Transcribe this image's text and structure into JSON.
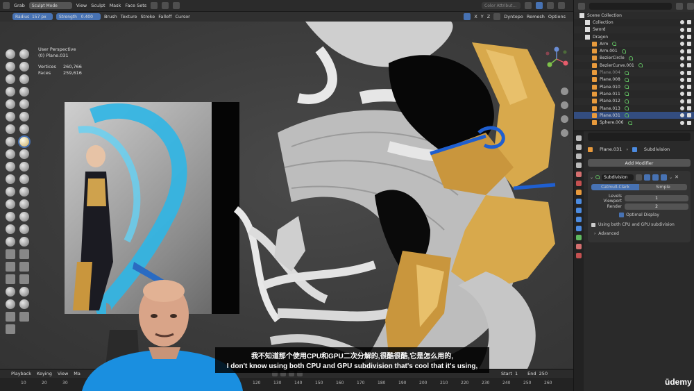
{
  "header": {
    "tool": "Grab",
    "mode": "Sculpt Mode",
    "menus": [
      "View",
      "Sculpt",
      "Mask",
      "Face Sets"
    ],
    "radius_label": "Radius",
    "radius_value": "157 px",
    "strength_label": "Strength",
    "strength_value": "0.400",
    "dropdowns": [
      "Brush",
      "Texture",
      "Stroke",
      "Falloff",
      "Cursor"
    ],
    "color_attr": "Color Attribut...",
    "axes": [
      "X",
      "Y",
      "Z"
    ],
    "dyntopo": "Dyntopo",
    "remesh": "Remesh",
    "options": "Options"
  },
  "viewport": {
    "view_name": "User Perspective",
    "object_name": "(0) Plane.031",
    "vertices_label": "Vertices",
    "vertices_value": "260,766",
    "faces_label": "Faces",
    "faces_value": "259,616"
  },
  "outliner": {
    "items": [
      {
        "label": "Scene Collection",
        "type": "scene"
      },
      {
        "label": "Collection",
        "type": "coll"
      },
      {
        "label": "Sword",
        "type": "coll"
      },
      {
        "label": "Dragon",
        "type": "coll"
      },
      {
        "label": "Arm",
        "type": "obj"
      },
      {
        "label": "Arm.001",
        "type": "obj"
      },
      {
        "label": "BezierCircle",
        "type": "obj"
      },
      {
        "label": "BezierCurve.001",
        "type": "obj"
      },
      {
        "label": "Plane.004",
        "type": "obj",
        "dim": true
      },
      {
        "label": "Plane.008",
        "type": "obj"
      },
      {
        "label": "Plane.010",
        "type": "obj"
      },
      {
        "label": "Plane.011",
        "type": "obj"
      },
      {
        "label": "Plane.012",
        "type": "obj"
      },
      {
        "label": "Plane.013",
        "type": "obj"
      },
      {
        "label": "Plane.031",
        "type": "obj",
        "selected": true
      },
      {
        "label": "Sphere.006",
        "type": "obj"
      }
    ]
  },
  "properties": {
    "object": "Plane.031",
    "modifier_crumb": "Subdivision",
    "add_modifier": "Add Modifier",
    "modifier_name": "Subdivision",
    "type_a": "Catmull-Clark",
    "type_b": "Simple",
    "levels_label": "Levels Viewport",
    "levels_value": "1",
    "render_label": "Render",
    "render_value": "2",
    "optimal_display": "Optimal Display",
    "note": "Using both CPU and GPU subdivision",
    "advanced": "Advanced"
  },
  "timeline": {
    "menus": [
      "Playback",
      "Keying",
      "View",
      "Ma"
    ],
    "ticks": [
      "10",
      "20",
      "30",
      "120",
      "130",
      "140",
      "150",
      "160",
      "170",
      "180",
      "190",
      "200",
      "210",
      "220",
      "230",
      "240",
      "250",
      "260"
    ],
    "start_label": "Start",
    "start_value": "1",
    "end_label": "End",
    "end_value": "250"
  },
  "subtitles": {
    "zh": "我不知道那个使用CPU和GPU二次分解的,很酷很酷,它是怎么用的,",
    "en": "I don't know using both CPU and GPU subdivision that's cool that it's using,"
  },
  "watermark": "ūdemy",
  "colors": {
    "accent": "#4772b3",
    "gold": "#d8a94c",
    "selected_row": "#334d80",
    "modifier_icon": "#5fb95f"
  }
}
